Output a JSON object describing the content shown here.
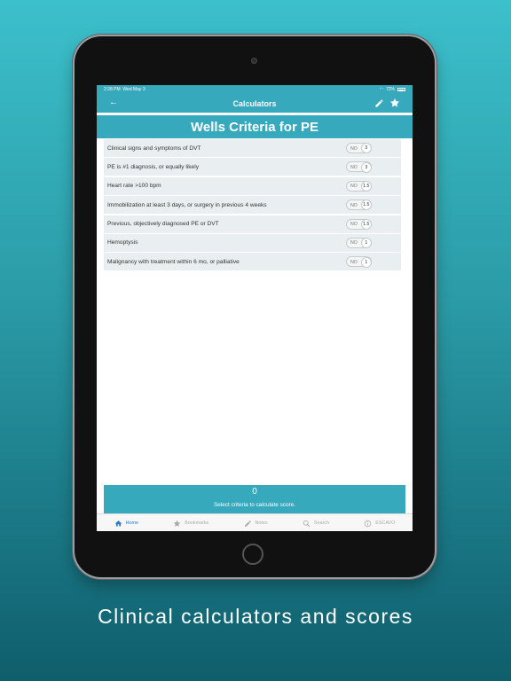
{
  "status_bar": {
    "time": "2:28 PM",
    "date": "Wed May 3",
    "battery": "72%"
  },
  "nav": {
    "title": "Calculators"
  },
  "calculator": {
    "title": "Wells Criteria for PE"
  },
  "criteria": [
    {
      "label": "Clinical signs and symptoms of DVT",
      "toggle_off": "NO",
      "points": "3"
    },
    {
      "label": "PE is #1 diagnosis, or equally likely",
      "toggle_off": "NO",
      "points": "3"
    },
    {
      "label": "Heart rate >100 bpm",
      "toggle_off": "NO",
      "points": "1.5"
    },
    {
      "label": "Immobilization at least 3 days, or surgery in previous 4 weeks",
      "toggle_off": "NO",
      "points": "1.5"
    },
    {
      "label": "Previous, objectively diagnosed PE or DVT",
      "toggle_off": "NO",
      "points": "1.5"
    },
    {
      "label": "Hemoptysis",
      "toggle_off": "NO",
      "points": "1"
    },
    {
      "label": "Malignancy with treatment within 6 mo, or palliative",
      "toggle_off": "NO",
      "points": "1"
    }
  ],
  "score": {
    "value": "0",
    "instruction": "Select criteria to calculate score."
  },
  "tabs": [
    {
      "label": "Home",
      "icon": "home-icon"
    },
    {
      "label": "Bookmarks",
      "icon": "star-icon"
    },
    {
      "label": "Notes",
      "icon": "pencil-icon"
    },
    {
      "label": "Search",
      "icon": "search-icon"
    },
    {
      "label": "ESCAVO",
      "icon": "info-icon"
    }
  ],
  "caption": "Clinical calculators and scores",
  "colors": {
    "accent": "#37a9bd",
    "active_tab": "#2a7cc4",
    "row_bg": "#e9eff0"
  }
}
